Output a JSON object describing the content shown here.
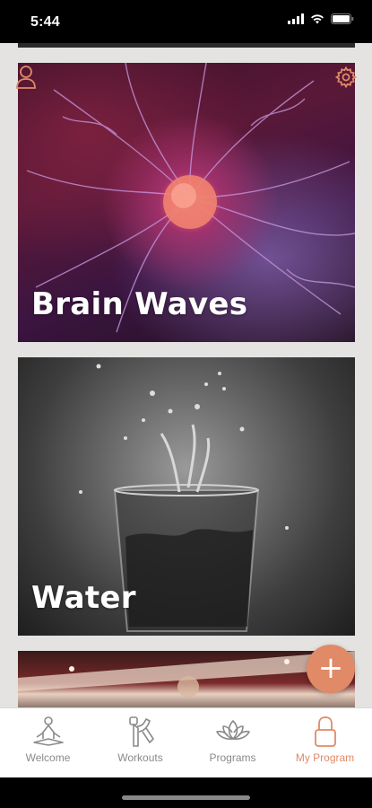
{
  "status_bar": {
    "time": "5:44",
    "icons": [
      "signal-icon",
      "wifi-icon",
      "battery-icon"
    ]
  },
  "header": {
    "profile_icon": "user-outline-icon",
    "settings_icon": "gear-icon"
  },
  "cards": [
    {
      "title": "Brain Waves",
      "image": "plasma-ball-neuron"
    },
    {
      "title": "Water",
      "image": "water-splash-glass"
    },
    {
      "title": "",
      "image": "concert-lights"
    }
  ],
  "fab": {
    "label": "+",
    "icon": "plus-icon",
    "color": "#e08a68"
  },
  "tabs": [
    {
      "label": "Welcome",
      "icon": "meditation-icon",
      "active": false
    },
    {
      "label": "Workouts",
      "icon": "hand-grip-icon",
      "active": false
    },
    {
      "label": "Programs",
      "icon": "lotus-icon",
      "active": false
    },
    {
      "label": "My Program",
      "icon": "padlock-icon",
      "active": true
    }
  ],
  "colors": {
    "accent": "#e08a68",
    "tab_inactive": "#8a8a8a",
    "background": "#e4e3e1"
  }
}
